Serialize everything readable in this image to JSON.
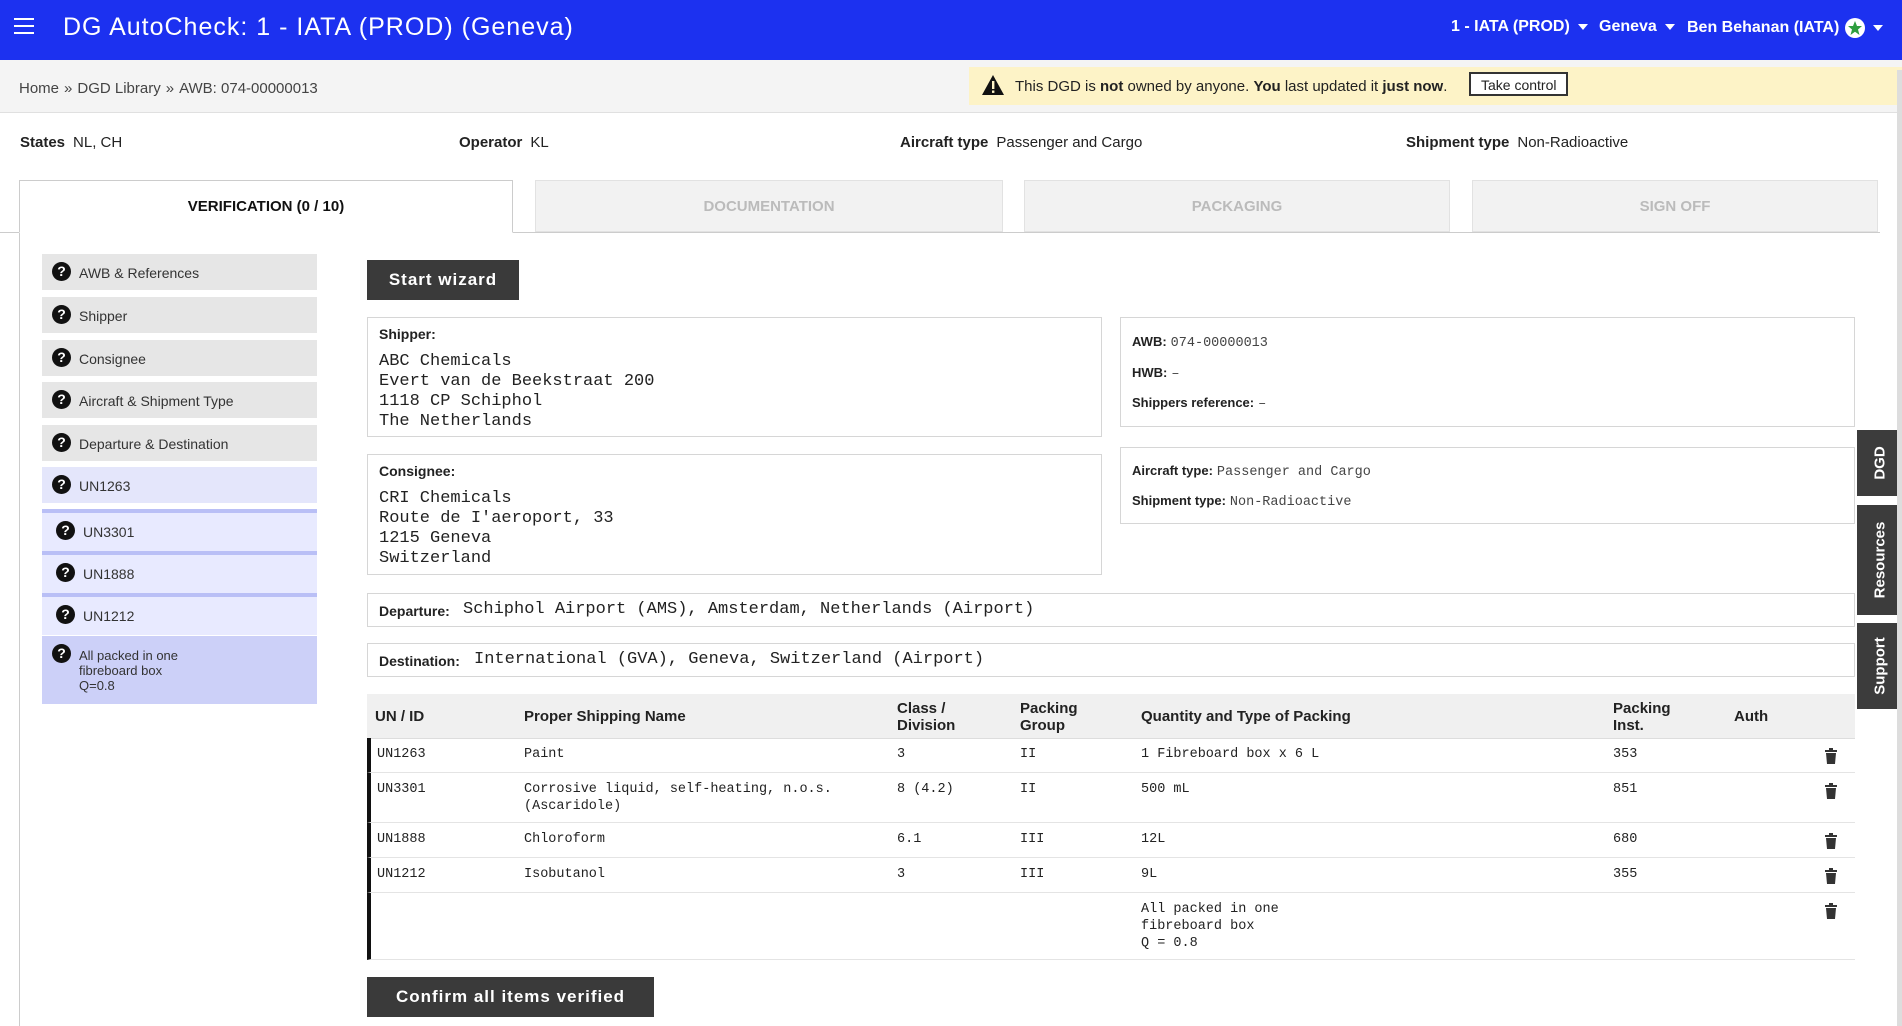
{
  "header": {
    "app_title": "DG AutoCheck: 1 - IATA (PROD) (Geneva)",
    "org_menu": "1 - IATA (PROD)",
    "location_menu": "Geneva",
    "user_menu": "Ben Behanan (IATA)",
    "bar_color": "#1c31f0"
  },
  "breadcrumb": [
    "Home",
    "DGD Library",
    "AWB: 074-00000013"
  ],
  "notice": {
    "t1": "This DGD is ",
    "t2": "not",
    "t3": " owned by anyone. ",
    "t4": "You",
    "t5": " last updated it ",
    "t6": "just now",
    "t7": ".",
    "button": "Take control",
    "icon": "warning-icon"
  },
  "summary": {
    "states_label": "States",
    "states": "NL, CH",
    "operator_label": "Operator",
    "operator": "KL",
    "aircraft_label": "Aircraft type",
    "aircraft": "Passenger and Cargo",
    "shipment_label": "Shipment type",
    "shipment": "Non-Radioactive"
  },
  "tabs": [
    "VERIFICATION (0 / 10)",
    "DOCUMENTATION",
    "PACKAGING",
    "SIGN OFF"
  ],
  "sidebar": [
    "AWB & References",
    "Shipper",
    "Consignee",
    "Aircraft & Shipment Type",
    "Departure & Destination",
    "UN1263",
    "UN3301",
    "UN1888",
    "UN1212"
  ],
  "sidebar_last": [
    "All packed in one",
    "fibreboard box",
    "Q=0.8"
  ],
  "wizard_button": "Start wizard",
  "shipper": {
    "title": "Shipper:",
    "lines": [
      "ABC Chemicals",
      "Evert van de Beekstraat 200",
      "1118 CP Schiphol",
      "The Netherlands"
    ]
  },
  "consignee": {
    "title": "Consignee:",
    "lines": [
      "CRI Chemicals",
      "Route de I'aeroport, 33",
      "1215 Geneva",
      "Switzerland"
    ]
  },
  "awb_box": {
    "awb_label": "AWB:",
    "awb": "074-00000013",
    "hwb_label": "HWB:",
    "hwb": "–",
    "ref_label": "Shippers reference:",
    "ref": "–"
  },
  "type_box": {
    "aircraft_label": "Aircraft type:",
    "aircraft": "Passenger and Cargo",
    "shipment_label": "Shipment type:",
    "shipment": "Non-Radioactive"
  },
  "departure": {
    "label": "Departure:",
    "value": "Schiphol Airport (AMS), Amsterdam, Netherlands (Airport)"
  },
  "destination": {
    "label": "Destination:",
    "value": "International (GVA), Geneva, Switzerland (Airport)"
  },
  "table": {
    "headers": {
      "un": "UN / ID",
      "psn": "Proper Shipping Name",
      "class1": "Class /",
      "class2": "Division",
      "pg1": "Packing",
      "pg2": "Group",
      "qty": "Quantity and Type of Packing",
      "pi1": "Packing",
      "pi2": "Inst.",
      "auth": "Auth"
    },
    "rows": [
      {
        "un": "UN1263",
        "psn": "Paint",
        "cls": "3",
        "pg": "II",
        "qty": "1 Fibreboard box x 6 L",
        "pi": "353"
      },
      {
        "un": "UN3301",
        "psn": "Corrosive liquid, self-heating, n.o.s.\n(Ascaridole)",
        "cls": "8 (4.2)",
        "pg": "II",
        "qty": "500 mL",
        "pi": "851"
      },
      {
        "un": "UN1888",
        "psn": "Chloroform",
        "cls": "6.1",
        "pg": "III",
        "qty": "12L",
        "pi": "680"
      },
      {
        "un": "UN1212",
        "psn": "Isobutanol",
        "cls": "3",
        "pg": "III",
        "qty": "9L",
        "pi": "355"
      },
      {
        "un": "",
        "psn": "",
        "cls": "",
        "pg": "",
        "qty": "All packed in one\nfibreboard box\nQ = 0.8",
        "pi": ""
      }
    ]
  },
  "confirm_button": "Confirm all items verified",
  "side_tabs": [
    "DGD",
    "Resources",
    "Support"
  ]
}
